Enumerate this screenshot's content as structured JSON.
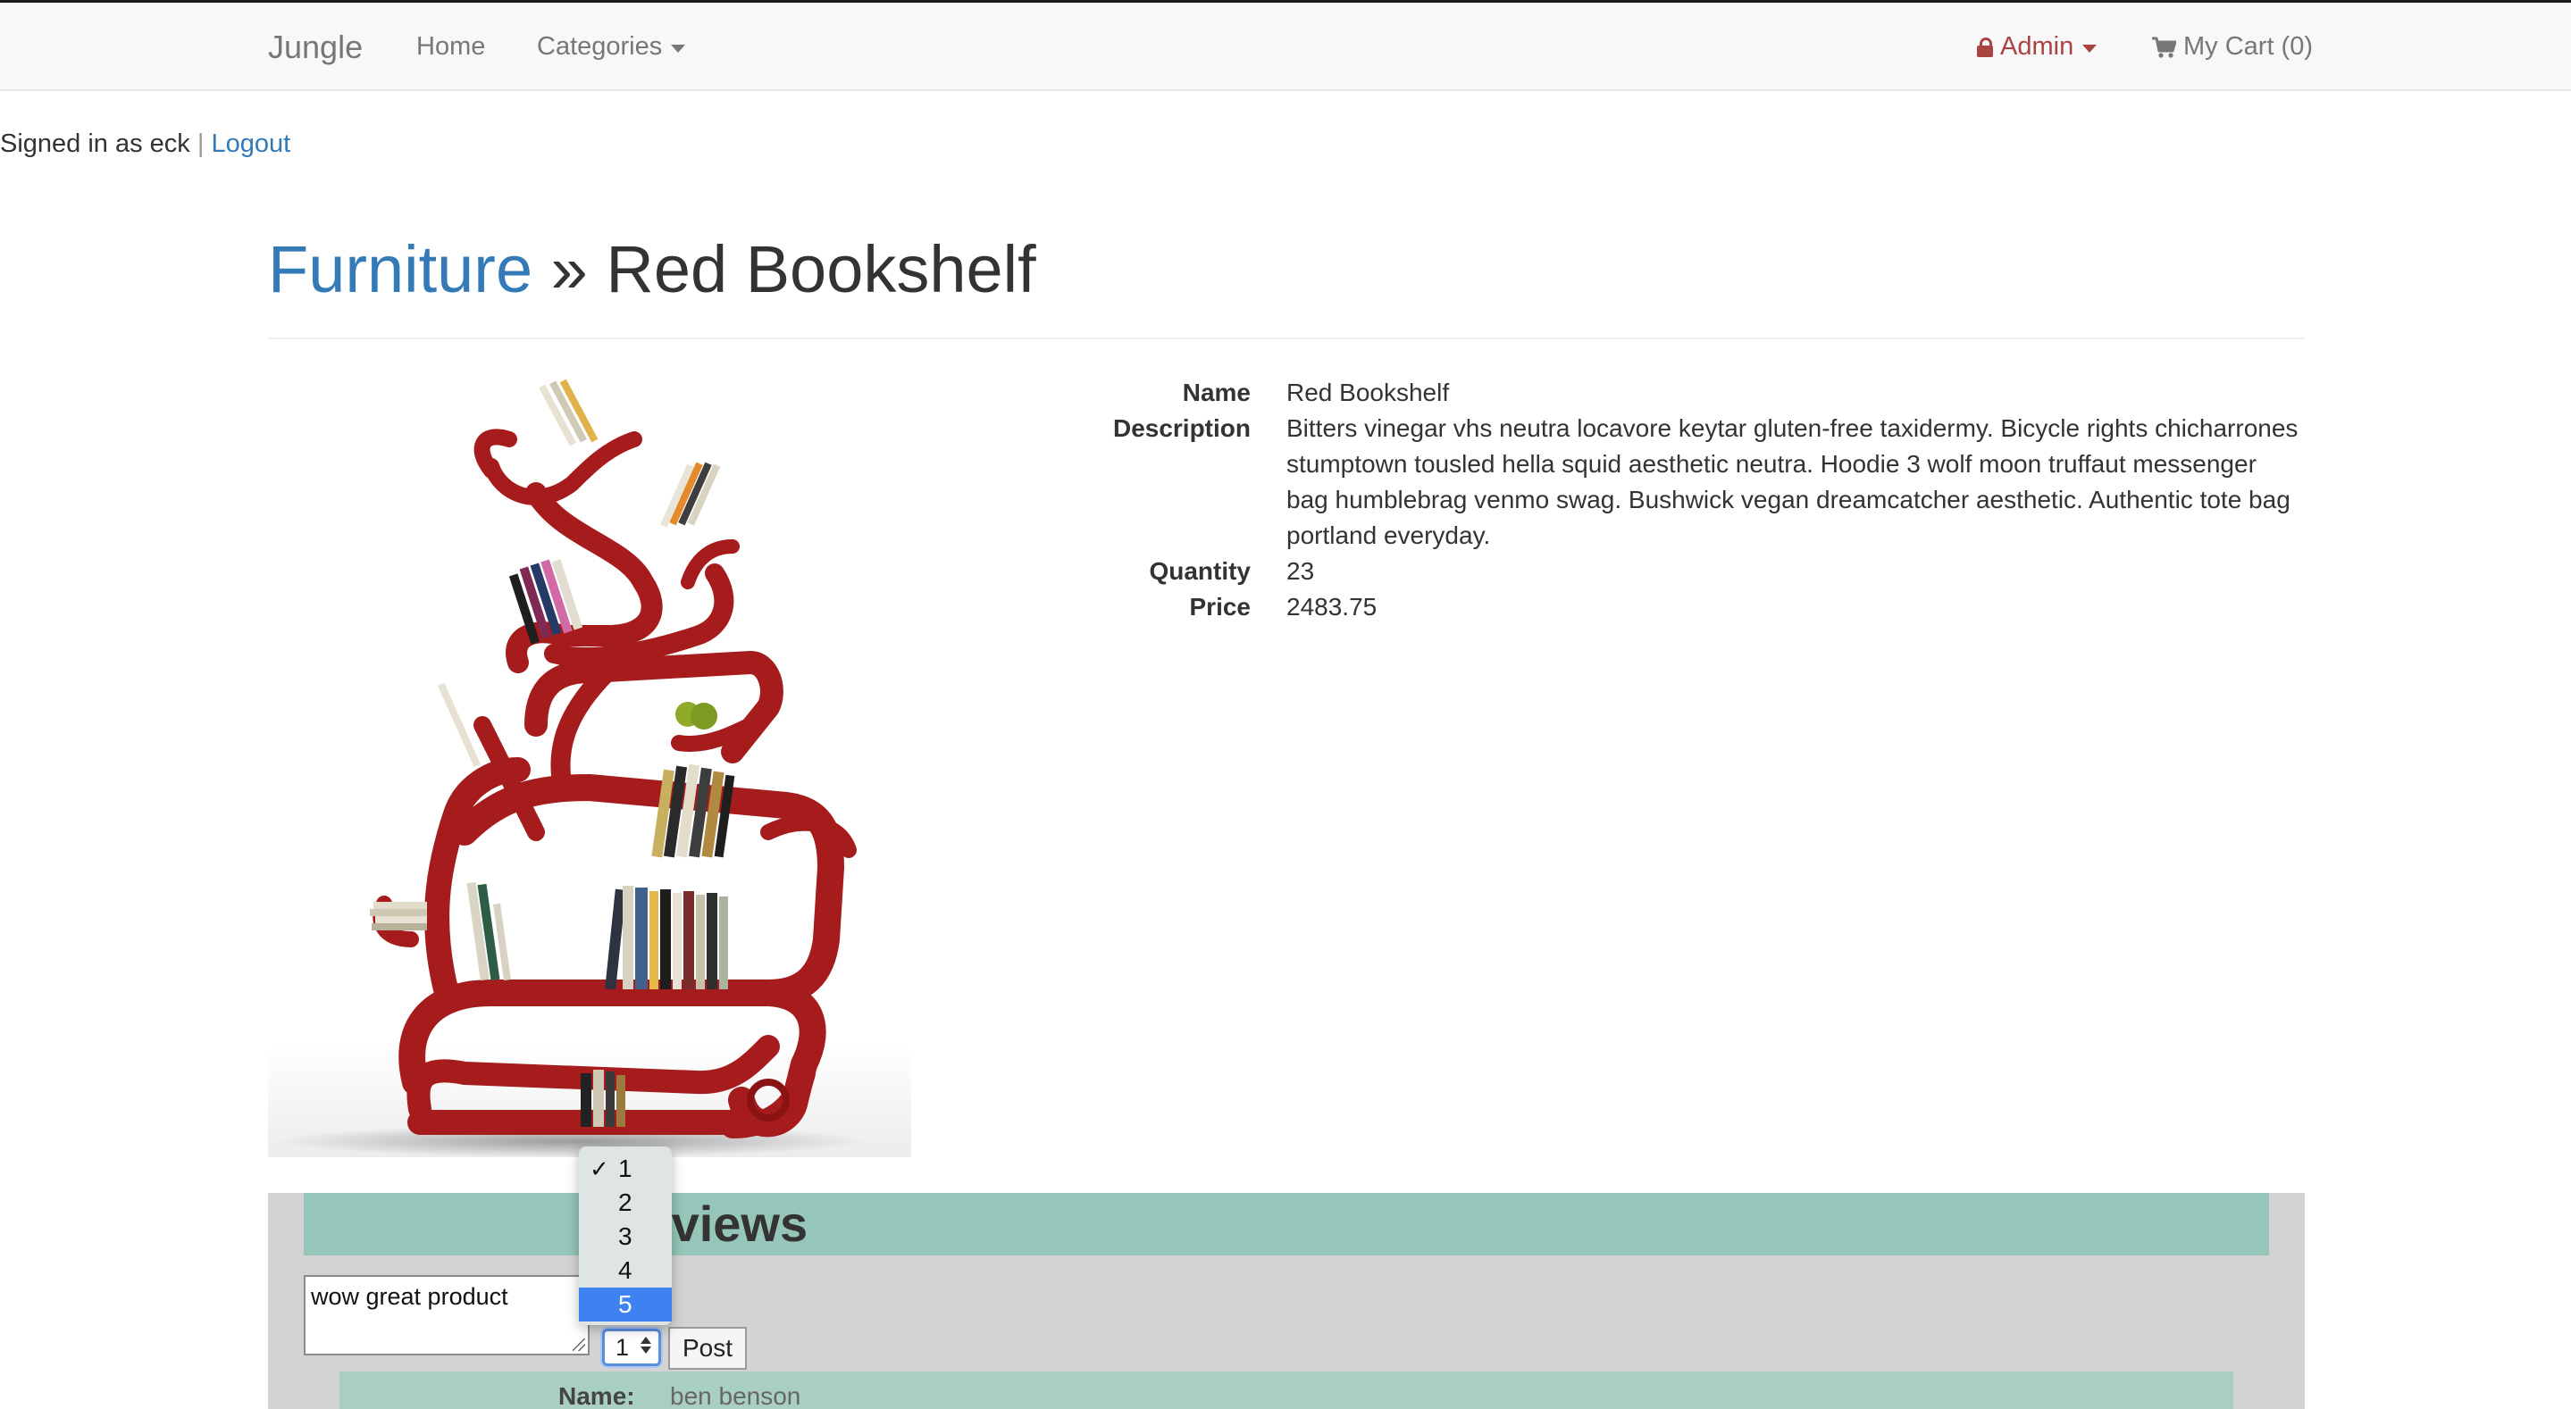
{
  "navbar": {
    "brand": "Jungle",
    "home": "Home",
    "categories": "Categories",
    "admin": "Admin",
    "cart": "My Cart (0)"
  },
  "session": {
    "signed_in_text": "Signed in as eck",
    "separator": "|",
    "logout": "Logout"
  },
  "breadcrumb": {
    "category": "Furniture",
    "separator": "»",
    "product": "Red Bookshelf"
  },
  "product": {
    "labels": {
      "name": "Name",
      "description": "Description",
      "quantity": "Quantity",
      "price": "Price"
    },
    "name": "Red Bookshelf",
    "description": "Bitters vinegar vhs neutra locavore keytar gluten-free taxidermy. Bicycle rights chicharrones stumptown tousled hella squid aesthetic neutra. Hoodie 3 wolf moon truffaut messenger bag humblebrag venmo swag. Bushwick vegan dreamcatcher aesthetic. Authentic tote bag portland everyday.",
    "quantity": "23",
    "price": "2483.75"
  },
  "reviews": {
    "title": "Reviews",
    "textarea_value": "wow great product",
    "rating_value": "1",
    "rating_options": [
      "1",
      "2",
      "3",
      "4",
      "5"
    ],
    "highlighted_option": "5",
    "post_label": "Post",
    "items": [
      {
        "name_label": "Name:",
        "name": "ben benson"
      }
    ]
  },
  "colors": {
    "link": "#337ab7",
    "admin": "#a94442",
    "reviews_header": "#96c6b9",
    "reviews_bg": "#d3d3d3",
    "bookshelf_red": "#a61c1c",
    "option_highlight": "#3e82f1"
  },
  "icons": {
    "admin": "lock-icon",
    "cart": "shopping-cart-icon",
    "dropdown": "caret-down-icon",
    "select_arrows": "updown-arrows-icon",
    "selected_option": "checkmark-icon"
  }
}
